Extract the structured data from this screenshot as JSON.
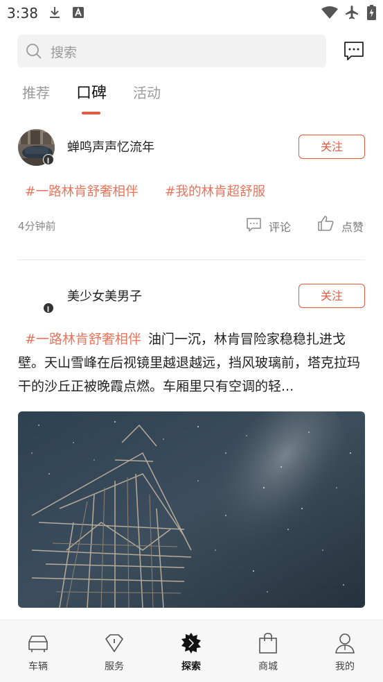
{
  "status_bar": {
    "time": "3:38",
    "left_icons": [
      "download-icon",
      "a-badge-icon"
    ],
    "right_icons": [
      "wifi-icon",
      "airplane-icon",
      "battery-charging-icon"
    ]
  },
  "header": {
    "search_placeholder": "搜索",
    "message_icon": "message-icon"
  },
  "tabs": [
    {
      "label": "推荐",
      "active": false
    },
    {
      "label": "口碑",
      "active": true
    },
    {
      "label": "活动",
      "active": false
    }
  ],
  "accent_color": "#e8583d",
  "posts": [
    {
      "username": "蝉鸣声声忆流年",
      "follow_label": "关注",
      "tags": [
        "#一路林肯舒奢相伴",
        "#我的林肯超舒服"
      ],
      "time": "4分钟前",
      "comment_label": "评论",
      "like_label": "点赞"
    },
    {
      "username": "美少女美男子",
      "follow_label": "关注",
      "tag": "#一路林肯舒奢相伴",
      "text": "油门一沉，林肯冒险家稳稳扎进戈壁。天山雪峰在后视镜里越退越远，挡风玻璃前，塔克拉玛干的沙丘正被晚霞点燃。车厢里只有空调的轻..."
    }
  ],
  "bottom_nav": [
    {
      "label": "车辆",
      "icon": "car-icon",
      "active": false
    },
    {
      "label": "服务",
      "icon": "diamond-icon",
      "active": false
    },
    {
      "label": "探索",
      "icon": "explore-icon",
      "active": true
    },
    {
      "label": "商城",
      "icon": "shopping-bag-icon",
      "active": false
    },
    {
      "label": "我的",
      "icon": "profile-icon",
      "active": false
    }
  ]
}
